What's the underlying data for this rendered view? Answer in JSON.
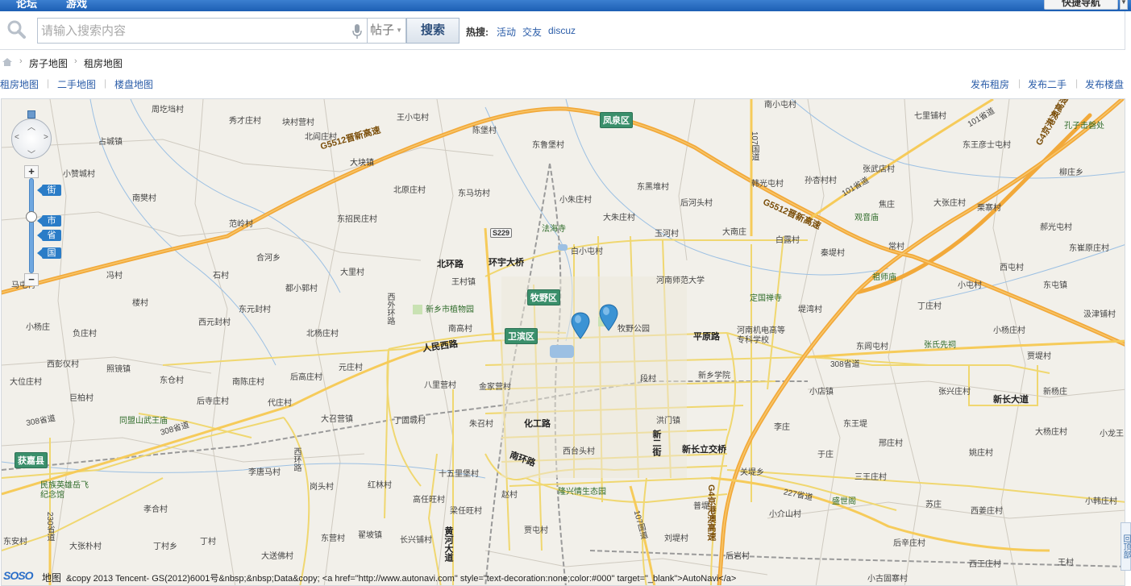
{
  "topnav": {
    "items": [
      "论坛",
      "游戏"
    ],
    "quick_nav": "快捷导航"
  },
  "search": {
    "placeholder": "请输入搜索内容",
    "scope": "帖子",
    "button": "搜索",
    "hot_label": "热搜:",
    "hot_links": [
      "活动",
      "交友",
      "discuz"
    ]
  },
  "breadcrumb": {
    "items": [
      "房子地图",
      "租房地图"
    ]
  },
  "tabs": {
    "left": [
      "租房地图",
      "二手地图",
      "楼盘地图"
    ],
    "right": [
      "发布租房",
      "发布二手",
      "发布楼盘"
    ]
  },
  "map": {
    "zoom_levels": [
      "街",
      "市",
      "省",
      "国"
    ],
    "districts": [
      "凤泉区",
      "牧野区",
      "卫滨区",
      "获嘉县"
    ],
    "road_numbers": [
      "S229"
    ],
    "highways": [
      "G5512晋新高速",
      "G4京港澳高速",
      "101省道",
      "107国道",
      "308省道",
      "227省道",
      "230省道"
    ],
    "places": [
      "周圪垱村",
      "秀才庄村",
      "块村营村",
      "王小屯村",
      "陈堡村",
      "东鲁堡村",
      "南小屯村",
      "七里铺村",
      "东王彦士屯村",
      "占城镇",
      "北阎庄村",
      "大块镇",
      "北原庄村",
      "东马坊村",
      "小朱庄村",
      "东黑堆村",
      "后河头村",
      "韩光屯村",
      "孙杏村村",
      "张武店村",
      "孔子击磬处",
      "柳庄乡",
      "南樊村",
      "小赞城村",
      "东招民庄村",
      "法海寺",
      "大朱庄村",
      "玉河村",
      "大南庄",
      "白露村",
      "焦庄",
      "观音庙",
      "大张庄村",
      "栗寨村",
      "郝光屯村",
      "东崔原庄村",
      "范岭村",
      "合河乡",
      "白小屯村",
      "秦堤村",
      "常村",
      "西屯村",
      "冯村",
      "石村",
      "都小郭村",
      "大里村",
      "北环路",
      "环宇大桥",
      "王村镇",
      "河南师范大学",
      "定国禅寺",
      "祖师庙",
      "小屯村",
      "东屯镇",
      "马屯村",
      "楼村",
      "西元封村",
      "东元封村",
      "新乡市植物园",
      "西外环路",
      "牧野公园",
      "平原路",
      "河南机电高等专科学校",
      "堤湾村",
      "丁庄村",
      "汲津铺村",
      "小杨庄",
      "负庄村",
      "北杨庄村",
      "南高村",
      "人民西路",
      "东闾屯村",
      "张氏先祠",
      "小杨庄村",
      "贾堤村",
      "西彭仪村",
      "照镜镇",
      "元庄村",
      "新乡学院",
      "大位庄村",
      "东仓村",
      "南陈庄村",
      "后高庄村",
      "八里营村",
      "金家营村",
      "段村",
      "小店镇",
      "张兴庄村",
      "新长大道",
      "新杨庄",
      "巨柏村",
      "后寺庄村",
      "代庄村",
      "丁固城村",
      "朱召村",
      "化工路",
      "洪门镇",
      "李庄",
      "东王堤",
      "大杨庄村",
      "小龙王",
      "同盟山武王庙",
      "大召营镇",
      "新二街",
      "新长立交桥",
      "邢庄村",
      "西台头村",
      "南环路",
      "李唐马村",
      "岗头村",
      "红林村",
      "十五里堡村",
      "关堤乡",
      "于庄",
      "姚庄村",
      "民族英雄岳飞纪念馆",
      "高任旺村",
      "赵村",
      "隆兴情生态园",
      "三王庄村",
      "孝合村",
      "梁任旺村",
      "普堤",
      "小介山村",
      "盛世阁",
      "苏庄",
      "西姜庄村",
      "小韩庄村",
      "大张朴村",
      "丁村乡",
      "丁村",
      "东营村",
      "翟坡镇",
      "长兴铺村",
      "贾屯村",
      "刘堤村",
      "大送佛村",
      "后岩村",
      "后辛庄村",
      "东安村",
      "西王庄村",
      "王村",
      "小古固寨村",
      "西环路",
      "黄河大道"
    ],
    "footer": {
      "logo": "SOSO",
      "logo_suffix": "地图",
      "copyright": "&copy 2013 Tencent- GS(2012)6001号&nbsp;&nbsp;Data&copy; <a href=\"http://www.autonavi.com\" style=\"text-decoration:none;color:#000\" target=\"_blank\">AutoNavi</a>"
    },
    "back_top": "回顶部"
  }
}
